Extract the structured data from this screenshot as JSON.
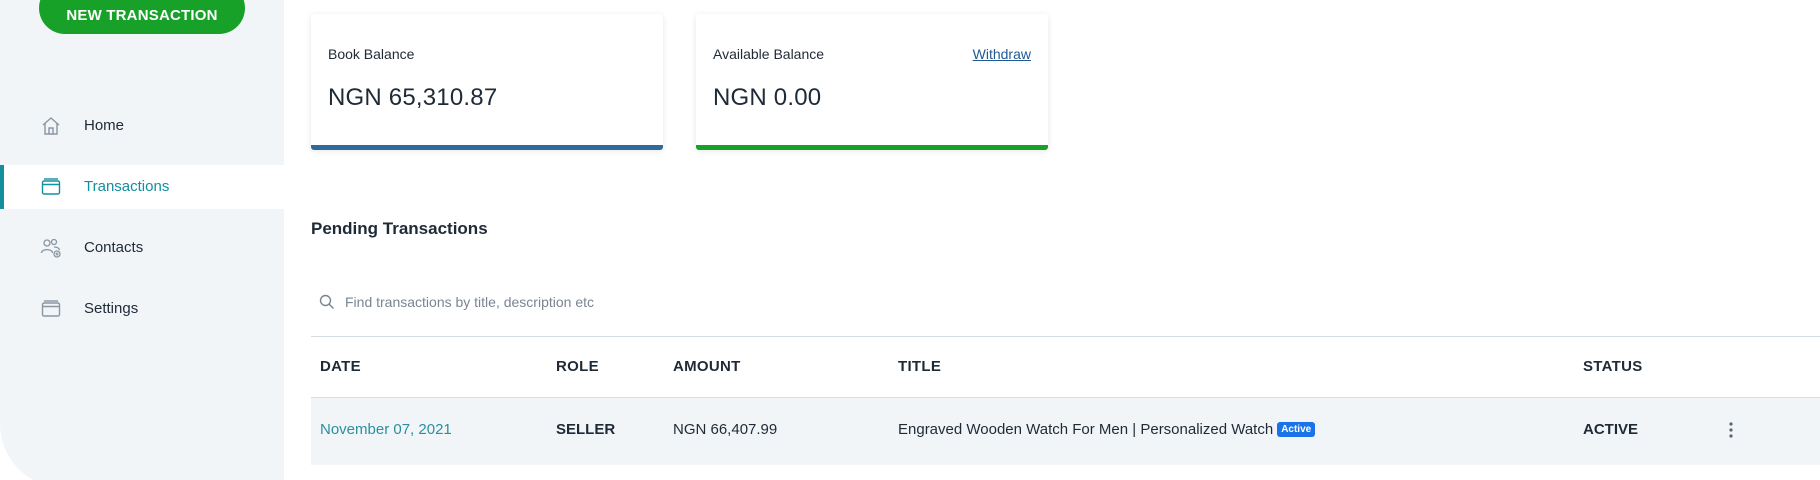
{
  "sidebar": {
    "new_transaction_label": "NEW TRANSACTION",
    "items": [
      {
        "label": "Home",
        "icon": "home-icon",
        "active": false
      },
      {
        "label": "Transactions",
        "icon": "transactions-icon",
        "active": true
      },
      {
        "label": "Contacts",
        "icon": "contacts-icon",
        "active": false
      },
      {
        "label": "Settings",
        "icon": "settings-icon",
        "active": false
      }
    ]
  },
  "cards": {
    "book": {
      "label": "Book Balance",
      "amount": "NGN 65,310.87",
      "bar_color": "#2f6a9c"
    },
    "available": {
      "label": "Available Balance",
      "amount": "NGN 0.00",
      "action": "Withdraw",
      "bar_color": "#18a128"
    }
  },
  "pending": {
    "title": "Pending Transactions",
    "search_placeholder": "Find transactions by title, description etc",
    "columns": [
      "DATE",
      "ROLE",
      "AMOUNT",
      "TITLE",
      "STATUS"
    ],
    "rows": [
      {
        "date": "November 07, 2021",
        "role": "SELLER",
        "amount": "NGN 66,407.99",
        "title": "Engraved Wooden Watch For Men | Personalized Watch",
        "badge": "Active",
        "status": "ACTIVE"
      }
    ]
  },
  "colors": {
    "accent_teal": "#138fa0",
    "primary_green": "#18a128",
    "badge_blue": "#1a73e8"
  }
}
